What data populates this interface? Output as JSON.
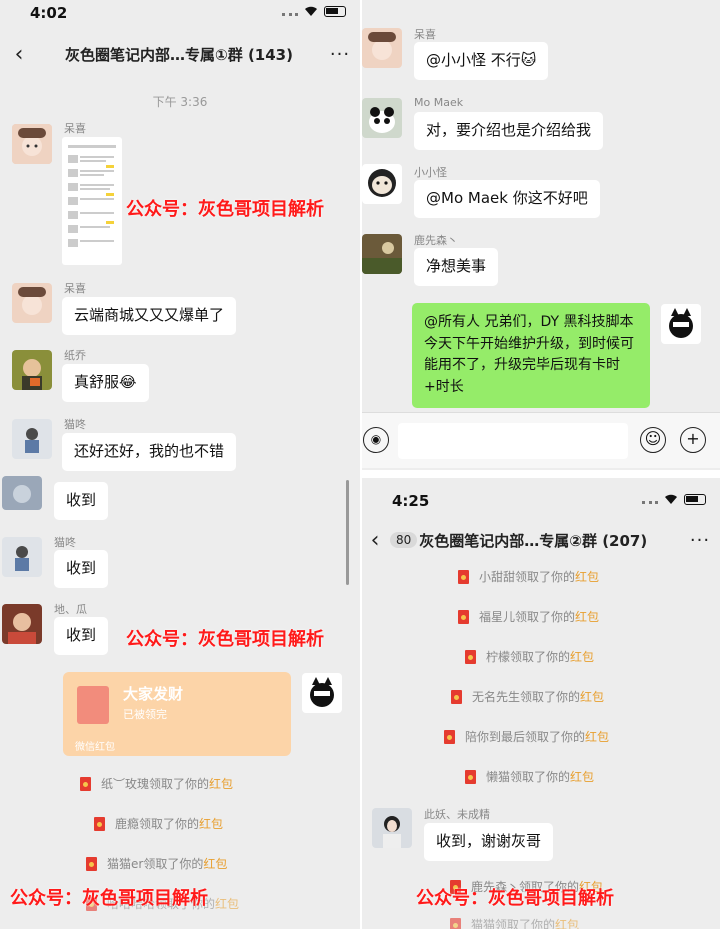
{
  "left": {
    "status_time": "4:02",
    "title": "灰色圈笔记内部…专属①群 (143)",
    "timestamp": "下午 3:36",
    "messages": [
      {
        "sender": "呆喜",
        "text": ""
      },
      {
        "sender": "呆喜",
        "text": "云端商城又又又爆单了"
      },
      {
        "sender": "纸乔",
        "text": "真舒服😂"
      },
      {
        "sender": "猫咚",
        "text": "还好还好，我的也不错"
      },
      {
        "sender": "",
        "text": "收到"
      },
      {
        "sender": "猫咚",
        "text": "收到"
      },
      {
        "sender": "地、瓜",
        "text": "收到"
      }
    ],
    "card": {
      "title": "大家发财",
      "sub": "已被领完",
      "footer": "微信红包"
    },
    "red_packets": [
      {
        "name": "纸︶玫瑰",
        "mid": "领取了你的",
        "hl": "红包"
      },
      {
        "name": "鹿瘾",
        "mid": "领取了你的",
        "hl": "红包"
      },
      {
        "name": "猫猫er",
        "mid": "领取了你的",
        "hl": "红包"
      },
      {
        "name": "哈哈哈哈",
        "mid": "领取了你的",
        "hl": "红包"
      }
    ]
  },
  "right_top": {
    "messages": [
      {
        "sender": "呆喜",
        "text": "@小小怪 不行🐱"
      },
      {
        "sender": "Mo Maek",
        "text": "对，要介绍也是介绍给我"
      },
      {
        "sender": "小小怪",
        "text": "@Mo Maek 你这不好吧"
      },
      {
        "sender": "鹿先森丶",
        "text": "净想美事"
      }
    ],
    "own_message": "@所有人 兄弟们，DY 黑科技脚本今天下午开始维护升级，到时候可能用不了，升级完毕后现有卡时+时长"
  },
  "right_bottom": {
    "status_time": "4:25",
    "unread": "80",
    "title": "灰色圈笔记内部…专属②群 (207)",
    "red_packets": [
      {
        "name": "小甜甜",
        "mid": "领取了你的",
        "hl": "红包"
      },
      {
        "name": "福星儿",
        "mid": "领取了你的",
        "hl": "红包"
      },
      {
        "name": "柠檬",
        "mid": "领取了你的",
        "hl": "红包"
      },
      {
        "name": "无名先生",
        "mid": "领取了你的",
        "hl": "红包"
      },
      {
        "name": "陪你到最后",
        "mid": "领取了你的",
        "hl": "红包"
      },
      {
        "name": "懒猫",
        "mid": "领取了你的",
        "hl": "红包"
      }
    ],
    "msg_sender": "此妖、未成精",
    "msg_text": "收到，谢谢灰哥",
    "red_packets_2": [
      {
        "name": "鹿先森丶",
        "mid": "领取了你的",
        "hl": "红包"
      },
      {
        "name": "猫猫",
        "mid": "领取了你的",
        "hl": "红包"
      }
    ]
  },
  "watermark": "公众号：灰色哥项目解析",
  "colors": {
    "chat_bg": "#ededed",
    "own_bubble": "#95ec69",
    "watermark": "#ff1a1a",
    "red_packet_highlight": "#e89f2f"
  }
}
